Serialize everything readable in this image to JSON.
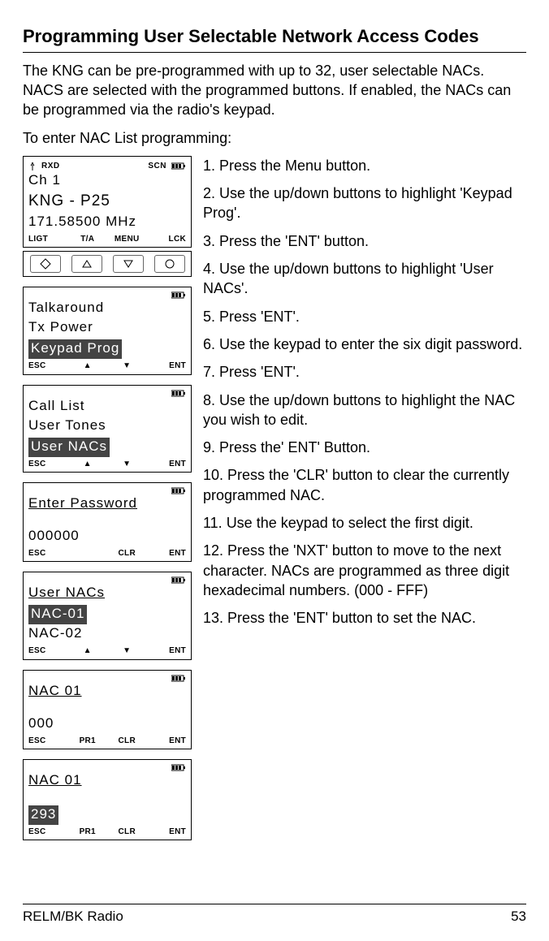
{
  "heading": "Programming User Selectable Network Access Codes",
  "intro1": "The KNG can be pre-programmed with up to 32, user selectable NACs. NACS are selected with the programmed buttons. If enabled, the NACs can be programmed via the radio's keypad.",
  "intro2": "To enter NAC List programming:",
  "steps": {
    "s1": "1.   Press the Menu button.",
    "s2": "2.   Use the up/down buttons to highlight 'Keypad Prog'.",
    "s3": "3.   Press the 'ENT' button.",
    "s4": "4.   Use the up/down buttons to highlight 'User NACs'.",
    "s5": "5.   Press 'ENT'.",
    "s6": "6.   Use the keypad to enter the six digit password.",
    "s7": "7.   Press 'ENT'.",
    "s8": "8.   Use the up/down buttons to highlight the NAC you wish to edit.",
    "s9": "9.   Press the' ENT' Button.",
    "s10": "10.  Press the 'CLR' button to clear the currently programmed NAC.",
    "s11": "11.  Use the keypad to select the first digit.",
    "s12": "12. Press the 'NXT' button to move to the next character. NACs are programmed as three digit hexadecimal numbers. (000 - FFF)",
    "s13": "13.  Press the 'ENT' button to set the NAC."
  },
  "lcd_main": {
    "status_rxd": "RXD",
    "status_scn": "SCN",
    "line1": "Ch 1",
    "line2": "KNG - P25",
    "line3": "171.58500 MHz",
    "soft": [
      "LIGT",
      "T/A",
      "MENU",
      "LCK"
    ]
  },
  "lcd_kp": {
    "l1": "Talkaround",
    "l2": "Tx Power",
    "l3": "Keypad Prog",
    "soft": [
      "ESC",
      "▲",
      "▼",
      "ENT"
    ]
  },
  "lcd_unacs": {
    "l1": "Call List",
    "l2": "User Tones",
    "l3": "User NACs",
    "soft": [
      "ESC",
      "▲",
      "▼",
      "ENT"
    ]
  },
  "lcd_pw": {
    "l1": "Enter Password",
    "l2": "",
    "l3": "000000",
    "soft": [
      "ESC",
      "",
      "CLR",
      "ENT"
    ]
  },
  "lcd_naclist": {
    "l1": "User NACs",
    "l2": "NAC-01",
    "l3": "NAC-02",
    "soft": [
      "ESC",
      "▲",
      "▼",
      "ENT"
    ]
  },
  "lcd_nac01a": {
    "l1": "NAC 01",
    "l2": "",
    "l3": "  000",
    "soft": [
      "ESC",
      "PR1",
      "CLR",
      "ENT"
    ]
  },
  "lcd_nac01b": {
    "l1": "NAC 01",
    "l2": "",
    "l3": " 293",
    "soft": [
      "ESC",
      "PR1",
      "CLR",
      "ENT"
    ]
  },
  "footer_left": "RELM/BK Radio",
  "footer_right": "53"
}
